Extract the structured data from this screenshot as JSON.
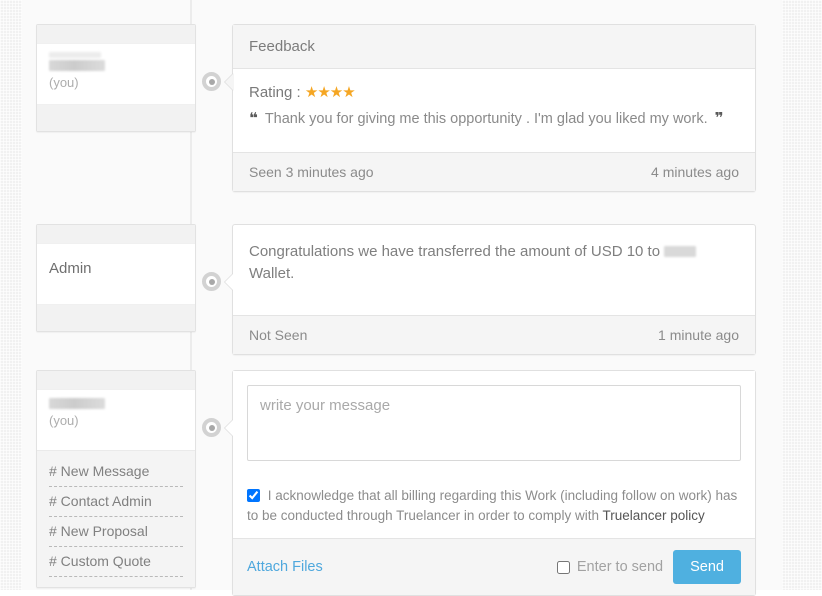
{
  "thread": {
    "messages": [
      {
        "author": {
          "name_redacted": true,
          "suffix": "(you)"
        },
        "header": "Feedback",
        "rating_label": "Rating :",
        "rating_value": 4,
        "rating_max": 5,
        "stars": "★★★★",
        "quote_open": "❝",
        "quote_close": "❞",
        "quote_text": "Thank you for giving me this opportunity . I'm glad you liked my work.",
        "seen_status": "Seen 3 minutes ago",
        "timestamp": "4 minutes ago"
      },
      {
        "author": {
          "name": "Admin"
        },
        "text_before_redaction": "Congratulations we have transferred the amount of USD 10 to",
        "text_after_redaction": "Wallet.",
        "seen_status": "Not Seen",
        "timestamp": "1 minute ago"
      }
    ]
  },
  "actions": {
    "items": [
      {
        "label": "# New Message"
      },
      {
        "label": "# Contact Admin"
      },
      {
        "label": "# New Proposal"
      },
      {
        "label": "# Custom Quote"
      }
    ]
  },
  "composer": {
    "author": {
      "name_redacted": true,
      "suffix": "(you)"
    },
    "placeholder": "write your message",
    "value": "",
    "acknowledge": {
      "checked": true,
      "text_part1": "I acknowledge that all billing regarding this Work (including follow on work) has to be conducted through Truelancer in order to comply with",
      "link_text": "Truelancer policy"
    },
    "attach_label": "Attach Files",
    "enter_to_send_label": "Enter to send",
    "enter_to_send_checked": false,
    "send_label": "Send"
  },
  "colors": {
    "star": "#f5a623",
    "send_button": "#4fb0e0",
    "link": "#4fa8dd",
    "panel_bg": "#f5f5f5",
    "page_bg": "#fafafa"
  }
}
